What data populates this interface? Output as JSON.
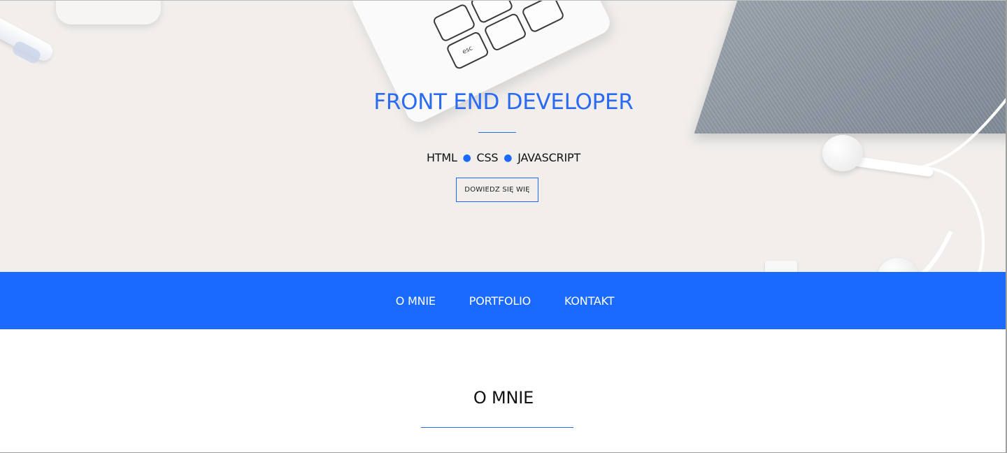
{
  "hero": {
    "title": "FRONT END DEVELOPER",
    "skills": [
      "HTML",
      "CSS",
      "JAVASCRIPT"
    ],
    "separator": "●",
    "cta_label": "DOWIEDZ SIĘ WIĘ",
    "keyboard_esc_label": "esc"
  },
  "nav": {
    "items": [
      {
        "label": "O MNIE"
      },
      {
        "label": "PORTFOLIO"
      },
      {
        "label": "KONTAKT"
      }
    ]
  },
  "about": {
    "title": "O MNIE"
  },
  "colors": {
    "accent": "#1a6aff",
    "hero_background": "#f1eeec",
    "text": "#111111"
  }
}
